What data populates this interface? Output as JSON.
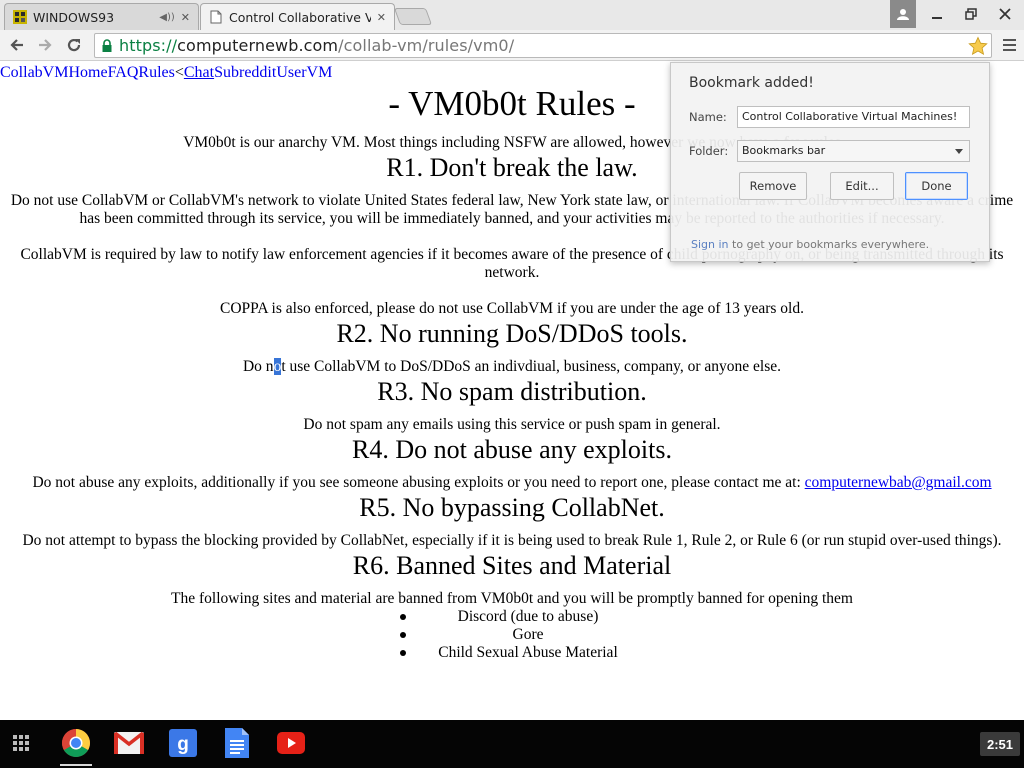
{
  "tabs": [
    {
      "title": "WINDOWS93",
      "favicon": "windows93-logo-icon",
      "audio": true
    },
    {
      "title": "Control Collaborative Virtu",
      "favicon": "page-icon",
      "active": true
    }
  ],
  "address_bar": {
    "scheme": "https://",
    "host": "computernewb.com",
    "path": "/collab-vm/rules/vm0/"
  },
  "page": {
    "nav": {
      "collabvm": "CollabVM",
      "home": "Home",
      "faq": "FAQ",
      "rules": "Rules",
      "lt": "<",
      "chat": "Chat",
      "subreddit": "Subreddit",
      "uservm": "UserVM"
    },
    "title": "- VM0b0t Rules -",
    "intro": "VM0b0t is our anarchy VM. Most things including NSFW are allowed, however we now have a few rules",
    "rules": [
      {
        "heading": "R1. Don't break the law."
      },
      {
        "heading": "R2. No running DoS/DDoS tools."
      },
      {
        "heading": "R3. No spam distribution."
      },
      {
        "heading": "R4. Do not abuse any exploits."
      },
      {
        "heading": "R5. No bypassing CollabNet."
      },
      {
        "heading": "R6. Banned Sites and Material"
      }
    ],
    "r1_p1": "Do not use CollabVM or CollabVM's network to violate United States federal law, New York state law, or international law. If CollabVM becomes aware a crime has been committed through its service, you will be immediately banned, and your activities may be reported to the authorities if necessary.",
    "r1_p2": "CollabVM is required by law to notify law enforcement agencies if it becomes aware of the presence of child pornography on, or being transmitted through its network.",
    "r1_p3": "COPPA is also enforced, please do not use CollabVM if you are under the age of 13 years old.",
    "r2_pre": "Do n",
    "r2_sel": "o",
    "r2_post": "t use CollabVM to DoS/DDoS an indivdiual, business, company, or anyone else.",
    "r3_p": "Do not spam any emails using this service or push spam in general.",
    "r4_p": "Do not abuse any exploits, additionally if you see someone abusing exploits or you need to report one, please contact me at: ",
    "r4_email": "computernewbab@gmail.com",
    "r5_p": "Do not attempt to bypass the blocking provided by CollabNet, especially if it is being used to break Rule 1, Rule 2, or Rule 6 (or run stupid over-used things).",
    "r6_p": "The following sites and material are banned from VM0b0t and you will be promptly banned for opening them",
    "banned_list": [
      "Discord (due to abuse)",
      "Gore",
      "Child Sexual Abuse Material"
    ]
  },
  "bookmark_bubble": {
    "title": "Bookmark added!",
    "name_label": "Name:",
    "name_value": "Control Collaborative Virtual Machines!",
    "folder_label": "Folder:",
    "folder_value": "Bookmarks bar",
    "remove": "Remove",
    "edit": "Edit...",
    "done": "Done",
    "sign_in_link": "Sign in",
    "sign_in_rest": " to get your bookmarks everywhere."
  },
  "taskbar": {
    "apps": [
      "app-launcher-icon",
      "chrome-icon",
      "gmail-icon",
      "google-search-icon",
      "google-docs-icon",
      "youtube-icon"
    ],
    "clock": "2:51"
  },
  "colors": {
    "link": "#0000ee",
    "selection": "#3875d7",
    "secure_green": "#0b8043"
  }
}
